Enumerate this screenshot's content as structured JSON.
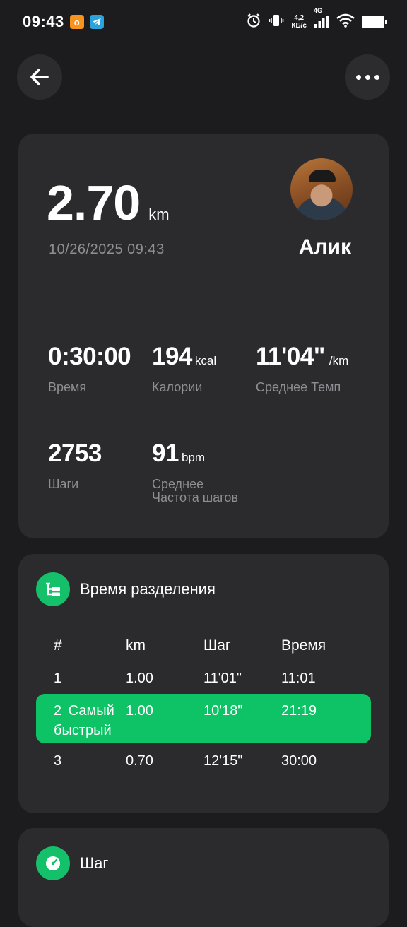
{
  "status_bar": {
    "time": "09:43",
    "app_ok": "о",
    "speed_value": "4,2",
    "speed_unit": "КБ/с",
    "network": "4G"
  },
  "nav": {
    "back_icon": "arrow-left-icon",
    "more_icon": "more-dots-icon"
  },
  "summary": {
    "distance": "2.70",
    "distance_unit": "km",
    "datetime": "10/26/2025 09:43",
    "user_name": "Алик",
    "stats": [
      {
        "value": "0:30:00",
        "unit": "",
        "label": "Время"
      },
      {
        "value": "194",
        "unit": "kcal",
        "label": "Калории"
      },
      {
        "value": "11'04\"",
        "unit": "/km",
        "label": "Среднее Темп"
      },
      {
        "value": "2753",
        "unit": "",
        "label": "Шаги"
      },
      {
        "value": "91",
        "unit": "bpm",
        "label": "Среднее\nЧастота шагов"
      }
    ]
  },
  "splits": {
    "title": "Время разделения",
    "icon": "splits-list-icon",
    "accent": "#14c06a",
    "columns": [
      "#",
      "km",
      "Шаг",
      "Время"
    ],
    "rows": [
      {
        "num": "1",
        "km": "1.00",
        "pace": "11'01\"",
        "time": "11:01"
      },
      {
        "num": "2  Самый быстрый",
        "km": "1.00",
        "pace": "10'18\"",
        "time": "21:19"
      },
      {
        "num": "3",
        "km": "0.70",
        "pace": "12'15\"",
        "time": "30:00"
      }
    ]
  },
  "pace": {
    "title": "Шаг",
    "icon": "speedometer-icon"
  }
}
